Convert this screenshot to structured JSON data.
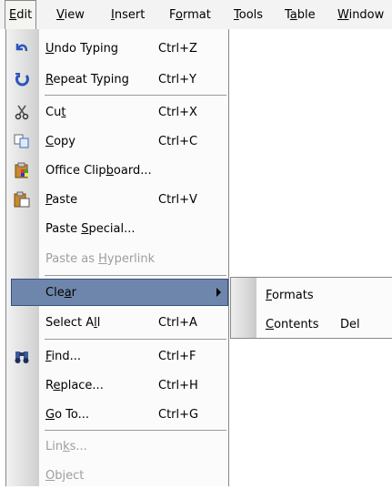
{
  "menubar": [
    {
      "label": "Edit",
      "u": "E",
      "rest": "dit"
    },
    {
      "label": "View",
      "u": "V",
      "rest": "iew"
    },
    {
      "label": "Insert",
      "u": "I",
      "rest": "nsert"
    },
    {
      "pre": "F",
      "u": "o",
      "rest": "rmat",
      "label": "Format"
    },
    {
      "label": "Tools",
      "u": "T",
      "rest": "ools"
    },
    {
      "pre": "T",
      "u": "a",
      "rest": "ble",
      "label": "Table"
    },
    {
      "label": "Window",
      "u": "W",
      "rest": "indow"
    }
  ],
  "menu": {
    "undo": {
      "pre": "",
      "u": "U",
      "rest": "ndo Typing",
      "shortcut": "Ctrl+Z",
      "icon": "undo-icon"
    },
    "repeat": {
      "pre": "",
      "u": "R",
      "rest": "epeat Typing",
      "shortcut": "Ctrl+Y",
      "icon": "repeat-icon"
    },
    "cut": {
      "pre": "Cu",
      "u": "t",
      "rest": "",
      "shortcut": "Ctrl+X",
      "icon": "scissors-icon"
    },
    "copy": {
      "pre": "",
      "u": "C",
      "rest": "opy",
      "shortcut": "Ctrl+C",
      "icon": "copy-icon"
    },
    "clipboard": {
      "pre": "Office Clip",
      "u": "b",
      "rest": "oard...",
      "shortcut": "",
      "icon": "office-clipboard-icon"
    },
    "paste": {
      "pre": "",
      "u": "P",
      "rest": "aste",
      "shortcut": "Ctrl+V",
      "icon": "paste-icon"
    },
    "paste_special": {
      "pre": "Paste ",
      "u": "S",
      "rest": "pecial...",
      "shortcut": ""
    },
    "paste_hyperlink": {
      "pre": "Paste as ",
      "u": "H",
      "rest": "yperlink",
      "shortcut": ""
    },
    "clear": {
      "pre": "Cle",
      "u": "a",
      "rest": "r",
      "shortcut": ""
    },
    "select_all": {
      "pre": "Select A",
      "u": "l",
      "rest": "l",
      "shortcut": "Ctrl+A"
    },
    "find": {
      "pre": "",
      "u": "F",
      "rest": "ind...",
      "shortcut": "Ctrl+F",
      "icon": "binoculars-icon"
    },
    "replace": {
      "pre": "R",
      "u": "e",
      "rest": "place...",
      "shortcut": "Ctrl+H"
    },
    "goto": {
      "pre": "",
      "u": "G",
      "rest": "o To...",
      "shortcut": "Ctrl+G"
    },
    "links": {
      "pre": "Lin",
      "u": "k",
      "rest": "s...",
      "shortcut": ""
    },
    "object": {
      "pre": "",
      "u": "O",
      "rest": "bject",
      "shortcut": ""
    }
  },
  "submenu": {
    "formats": {
      "pre": "",
      "u": "F",
      "rest": "ormats",
      "shortcut": ""
    },
    "contents": {
      "pre": "",
      "u": "C",
      "rest": "ontents",
      "shortcut": "Del"
    }
  },
  "colors": {
    "highlight": "#6f86ac",
    "highlight_border": "#37507e",
    "disabled": "#9e9e9e"
  }
}
